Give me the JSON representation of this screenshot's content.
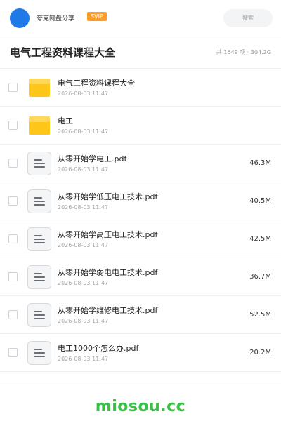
{
  "header": {
    "user_name": "夸克网盘分享",
    "badge": "SVIP",
    "search_placeholder": "搜索"
  },
  "folder": {
    "title": "电气工程资料课程大全",
    "summary": "共 1649 项 · 304.2G"
  },
  "items": [
    {
      "type": "folder",
      "name": "电气工程资料课程大全",
      "date": "2026-08-03 11:47",
      "size": ""
    },
    {
      "type": "folder",
      "name": "电工",
      "date": "2026-08-03 11:47",
      "size": ""
    },
    {
      "type": "file",
      "name": "从零开始学电工.pdf",
      "date": "2026-08-03 11:47",
      "size": "46.3M"
    },
    {
      "type": "file",
      "name": "从零开始学低压电工技术.pdf",
      "date": "2026-08-03 11:47",
      "size": "40.5M"
    },
    {
      "type": "file",
      "name": "从零开始学高压电工技术.pdf",
      "date": "2026-08-03 11:47",
      "size": "42.5M"
    },
    {
      "type": "file",
      "name": "从零开始学弱电电工技术.pdf",
      "date": "2026-08-03 11:47",
      "size": "36.7M"
    },
    {
      "type": "file",
      "name": "从零开始学维修电工技术.pdf",
      "date": "2026-08-03 11:47",
      "size": "52.5M"
    },
    {
      "type": "file",
      "name": "电工1000个怎么办.pdf",
      "date": "2026-08-03 11:47",
      "size": "20.2M"
    }
  ],
  "footer": {
    "watermark": "miosou.cc"
  },
  "colors": {
    "avatar": "#1f7ae8",
    "badge": "#ff9d2a",
    "folder": "#ffc61a",
    "watermark": "#38c144"
  }
}
